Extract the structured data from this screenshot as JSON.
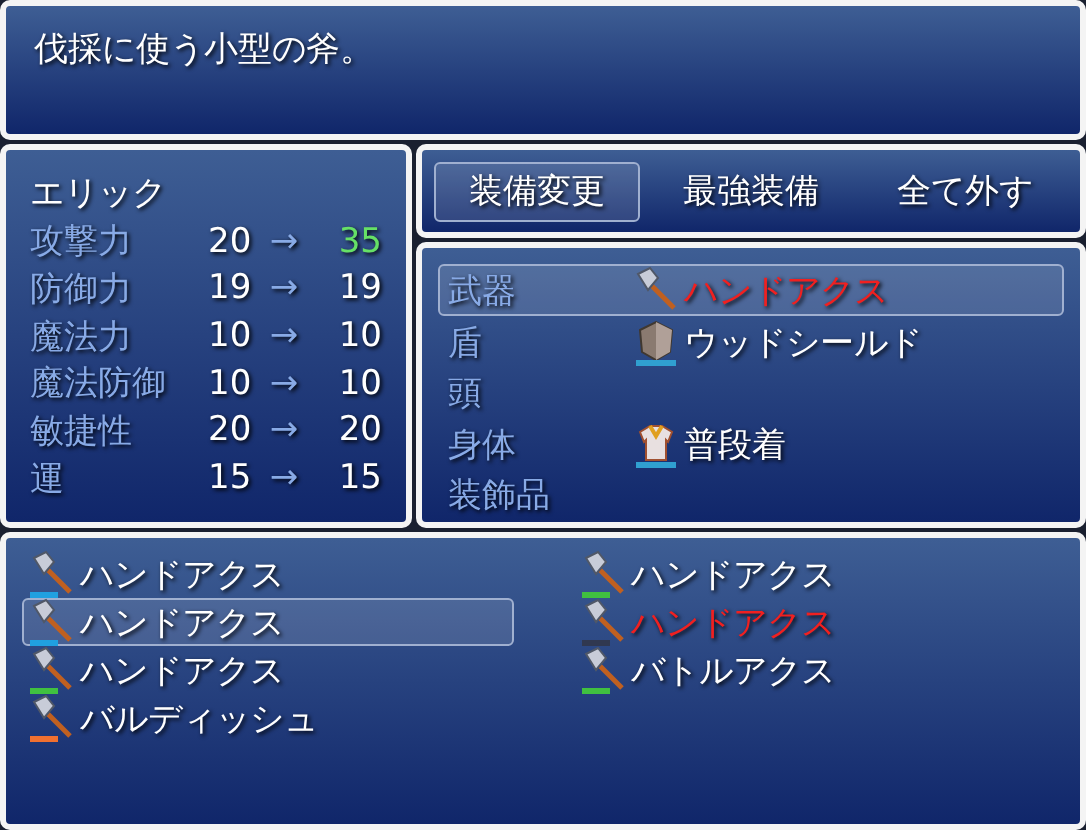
{
  "help": {
    "text": "伐採に使う小型の斧。"
  },
  "status": {
    "actor": "エリック",
    "rows": [
      {
        "label": "攻撃力",
        "current": "20",
        "arrow": "→",
        "next": "35",
        "increased": true
      },
      {
        "label": "防御力",
        "current": "19",
        "arrow": "→",
        "next": "19",
        "increased": false
      },
      {
        "label": "魔法力",
        "current": "10",
        "arrow": "→",
        "next": "10",
        "increased": false
      },
      {
        "label": "魔法防御",
        "current": "10",
        "arrow": "→",
        "next": "10",
        "increased": false
      },
      {
        "label": "敏捷性",
        "current": "20",
        "arrow": "→",
        "next": "20",
        "increased": false
      },
      {
        "label": "運",
        "current": "15",
        "arrow": "→",
        "next": "15",
        "increased": false
      }
    ]
  },
  "commands": [
    {
      "label": "装備変更",
      "selected": true
    },
    {
      "label": "最強装備",
      "selected": false
    },
    {
      "label": "全て外す",
      "selected": false
    }
  ],
  "slots": [
    {
      "label": "武器",
      "item": "ハンドアクス",
      "kind": "axe",
      "selected": true,
      "marked": true
    },
    {
      "label": "盾",
      "item": "ウッドシールド",
      "kind": "shield",
      "selected": false,
      "marked": false
    },
    {
      "label": "頭",
      "selected": false
    },
    {
      "label": "身体",
      "item": "普段着",
      "kind": "clothes",
      "selected": false,
      "marked": false
    },
    {
      "label": "装飾品",
      "selected": false
    }
  ],
  "items": [
    {
      "name": "ハンドアクス",
      "color": "#20a0e0",
      "selected": false,
      "marked": false
    },
    {
      "name": "ハンドアクス",
      "color": "#40c040",
      "selected": false,
      "marked": false
    },
    {
      "name": "ハンドアクス",
      "color": "#20a0e0",
      "selected": true,
      "marked": false
    },
    {
      "name": "ハンドアクス",
      "color": "#303850",
      "selected": false,
      "marked": true
    },
    {
      "name": "ハンドアクス",
      "color": "#40c040",
      "selected": false,
      "marked": false
    },
    {
      "name": "バトルアクス",
      "color": "#40c040",
      "selected": false,
      "marked": false
    },
    {
      "name": "バルディッシュ",
      "color": "#f07030",
      "selected": false,
      "marked": false
    }
  ]
}
